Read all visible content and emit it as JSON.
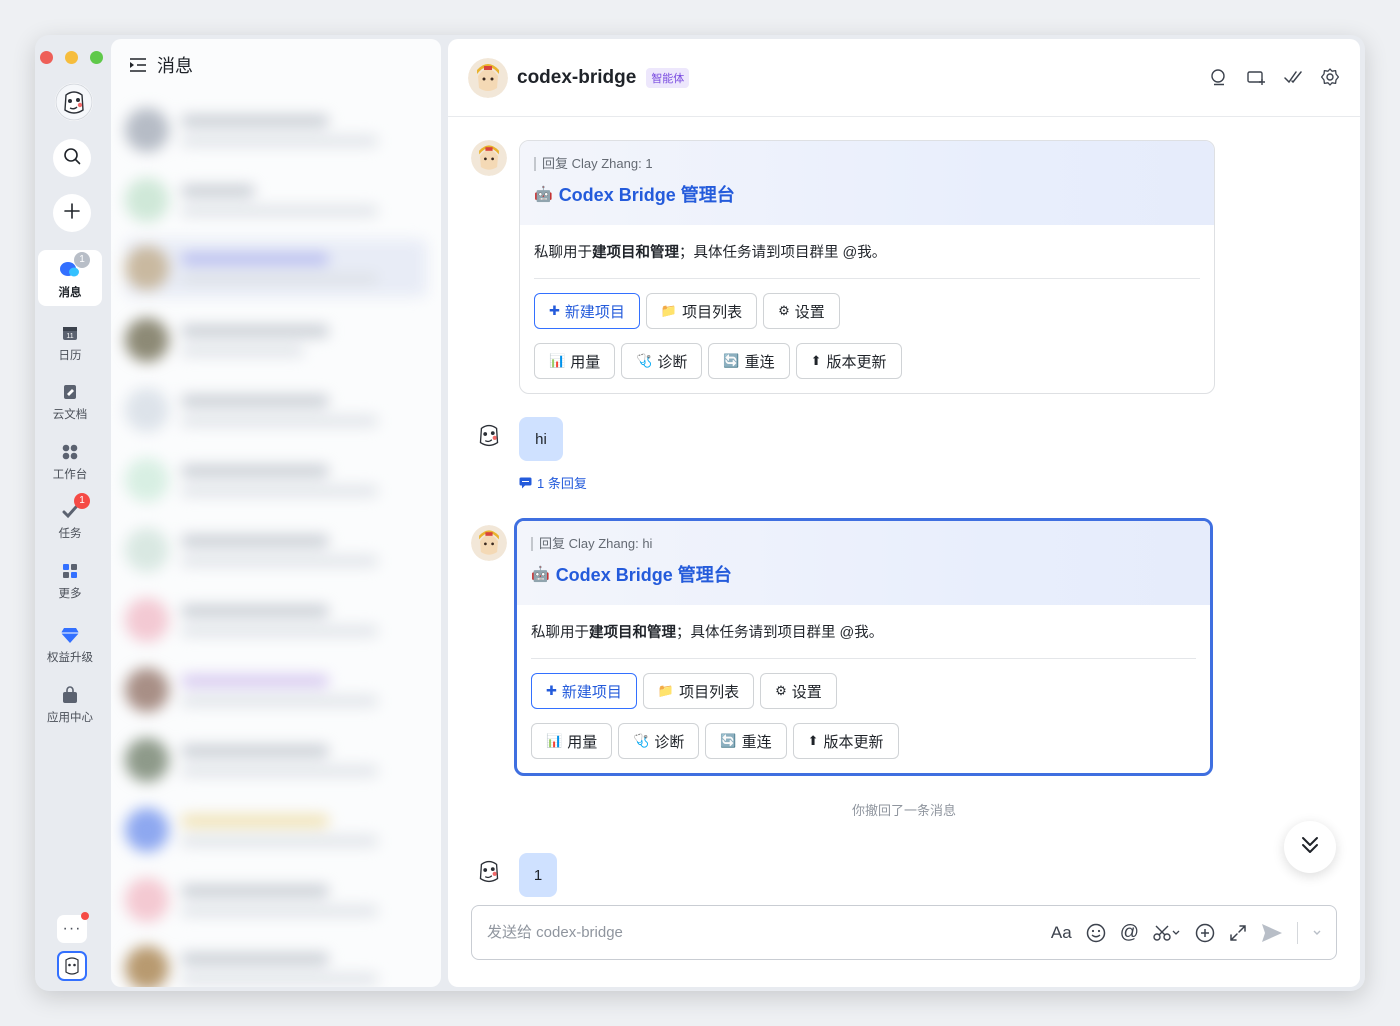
{
  "sidebar": {
    "items": [
      {
        "label": "消息",
        "badge": "1"
      },
      {
        "label": "日历"
      },
      {
        "label": "云文档"
      },
      {
        "label": "工作台"
      },
      {
        "label": "任务",
        "badge": "1"
      },
      {
        "label": "更多"
      },
      {
        "label": "权益升级"
      },
      {
        "label": "应用中心"
      }
    ],
    "more_label": "···"
  },
  "chat_list": {
    "title": "消息"
  },
  "chat": {
    "name": "codex-bridge",
    "tag": "智能体",
    "messages": {
      "card1": {
        "reply_line": "回复 Clay Zhang:  1",
        "title": "Codex Bridge 管理台",
        "text_prefix": "私聊用于",
        "text_bold": "建项目和管理",
        "text_suffix": "；具体任务请到项目群里 @我。",
        "buttons_row1": [
          "新建项目",
          "项目列表",
          "设置"
        ],
        "buttons_row2": [
          "用量",
          "诊断",
          "重连",
          "版本更新"
        ]
      },
      "user_hi": "hi",
      "reply_count": "1 条回复",
      "card2": {
        "reply_line": "回复 Clay Zhang:  hi",
        "title": "Codex Bridge 管理台",
        "text_prefix": "私聊用于",
        "text_bold": "建项目和管理",
        "text_suffix": "；具体任务请到项目群里 @我。",
        "buttons_row1": [
          "新建项目",
          "项目列表",
          "设置"
        ],
        "buttons_row2": [
          "用量",
          "诊断",
          "重连",
          "版本更新"
        ]
      },
      "system_note": "你撤回了一条消息",
      "user_last": "1"
    },
    "composer_placeholder": "发送给 codex-bridge"
  },
  "colors": {
    "accent": "#3370ff",
    "badge": "#f54a45",
    "bubble": "#cfe1ff",
    "card_title": "#245bdb"
  }
}
